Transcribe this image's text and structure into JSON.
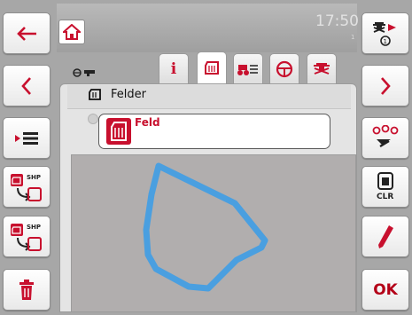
{
  "header": {
    "clock": "17:50",
    "clock_sub": "1"
  },
  "tabs": [
    {
      "name": "info",
      "label": "i",
      "active": false
    },
    {
      "name": "field",
      "active": true
    },
    {
      "name": "implement",
      "active": false
    },
    {
      "name": "steering",
      "active": false
    },
    {
      "name": "tractor",
      "active": false
    }
  ],
  "panel": {
    "title": "Felder"
  },
  "list": {
    "selected_item": "Feld"
  },
  "left_buttons": [
    "back",
    "previous",
    "list-menu",
    "shp-import",
    "shp-export",
    "delete"
  ],
  "right_buttons": {
    "labels": {
      "clear": "CLR",
      "ok": "OK",
      "shp": "SHP"
    }
  },
  "colors": {
    "accent": "#c8102e",
    "boundary": "#4a9fe0",
    "map_bg": "#b1aeae",
    "background": "#a7a7a7"
  }
}
